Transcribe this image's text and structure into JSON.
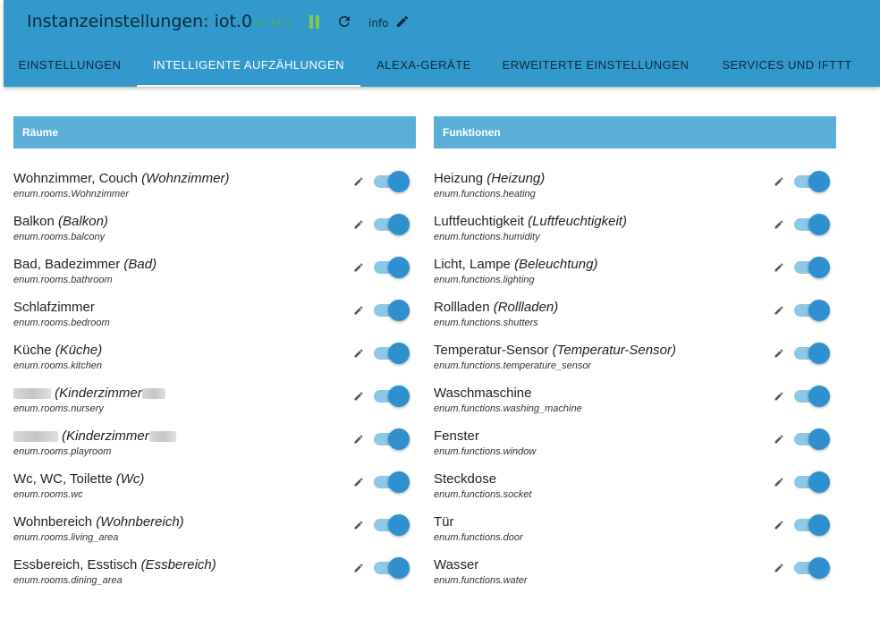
{
  "header": {
    "title": "Instanzeinstellungen: iot.0",
    "version": "v1.14.5",
    "info_label": "info"
  },
  "tabs": [
    {
      "label": "EINSTELLUNGEN"
    },
    {
      "label": "INTELLIGENTE AUFZÄHLUNGEN"
    },
    {
      "label": "ALEXA-GERÄTE"
    },
    {
      "label": "ERWEITERTE EINSTELLUNGEN"
    },
    {
      "label": "SERVICES UND IFTTT"
    }
  ],
  "rooms": {
    "header": "Räume",
    "items": [
      {
        "name": "Wohnzimmer, Couch",
        "alias": "(Wohnzimmer)",
        "enum": "enum.rooms.Wohnzimmer",
        "enabled": true
      },
      {
        "name": "Balkon",
        "alias": "(Balkon)",
        "enum": "enum.rooms.balcony",
        "enabled": true
      },
      {
        "name": "Bad, Badezimmer",
        "alias": "(Bad)",
        "enum": "enum.rooms.bathroom",
        "enabled": true
      },
      {
        "name": "Schlafzimmer",
        "alias": "",
        "enum": "enum.rooms.bedroom",
        "enabled": true
      },
      {
        "name": "Küche",
        "alias": "(Küche)",
        "enum": "enum.rooms.kitchen",
        "enabled": true
      },
      {
        "name": "",
        "alias": "(Kinderzimmer",
        "enum": "enum.rooms.nursery",
        "enabled": true
      },
      {
        "name": "",
        "alias": "(Kinderzimmer",
        "enum": "enum.rooms.playroom",
        "enabled": true
      },
      {
        "name": "Wc, WC, Toilette",
        "alias": "(Wc)",
        "enum": "enum.rooms.wc",
        "enabled": true
      },
      {
        "name": "Wohnbereich",
        "alias": "(Wohnbereich)",
        "enum": "enum.rooms.living_area",
        "enabled": true
      },
      {
        "name": "Essbereich, Esstisch",
        "alias": "(Essbereich)",
        "enum": "enum.rooms.dining_area",
        "enabled": true
      }
    ]
  },
  "functions": {
    "header": "Funktionen",
    "items": [
      {
        "name": "Heizung",
        "alias": "(Heizung)",
        "enum": "enum.functions.heating",
        "enabled": true
      },
      {
        "name": "Luftfeuchtigkeit",
        "alias": "(Luftfeuchtigkeit)",
        "enum": "enum.functions.humidity",
        "enabled": true
      },
      {
        "name": "Licht, Lampe",
        "alias": "(Beleuchtung)",
        "enum": "enum.functions.lighting",
        "enabled": true
      },
      {
        "name": "Rollladen",
        "alias": "(Rollladen)",
        "enum": "enum.functions.shutters",
        "enabled": true
      },
      {
        "name": "Temperatur-Sensor",
        "alias": "(Temperatur-Sensor)",
        "enum": "enum.functions.temperature_sensor",
        "enabled": true
      },
      {
        "name": "Waschmaschine",
        "alias": "",
        "enum": "enum.functions.washing_machine",
        "enabled": true
      },
      {
        "name": "Fenster",
        "alias": "",
        "enum": "enum.functions.window",
        "enabled": true
      },
      {
        "name": "Steckdose",
        "alias": "",
        "enum": "enum.functions.socket",
        "enabled": true
      },
      {
        "name": "Tür",
        "alias": "",
        "enum": "enum.functions.door",
        "enabled": true
      },
      {
        "name": "Wasser",
        "alias": "",
        "enum": "enum.functions.water",
        "enabled": true
      }
    ]
  },
  "icons": {
    "pause": "pause-icon",
    "reload": "reload-icon",
    "edit": "pencil-icon"
  },
  "colors": {
    "header_bg": "#3399cc",
    "section_bg": "#5aaed8",
    "toggle_knob": "#2e90cf",
    "toggle_track": "#8dc8e8",
    "version": "#4caf50"
  }
}
